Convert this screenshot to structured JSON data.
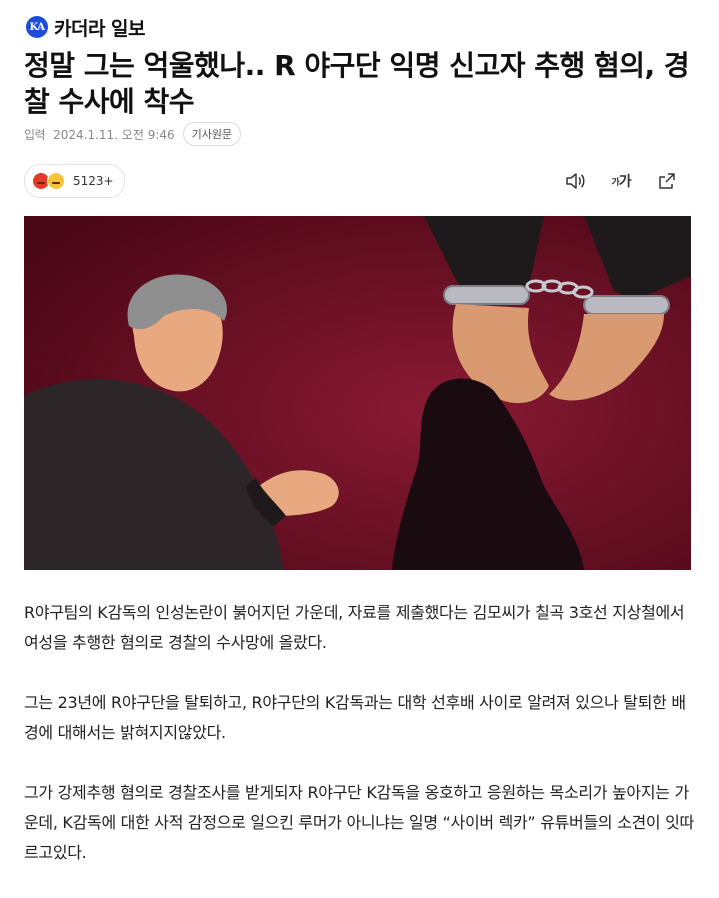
{
  "header": {
    "logo_mark": "KA",
    "brand": "카더라 일보"
  },
  "article": {
    "title": "정말 그는 억울했나.. R 야구단 익명 신고자 추행 혐의, 경찰 수사에 착수",
    "meta": {
      "label": "입력",
      "datetime": "2024.1.11. 오전 9:46",
      "original_button": "기사원문"
    },
    "reactions": {
      "icons": [
        "angry-emoji",
        "laugh-emoji"
      ],
      "count": "5123+"
    },
    "toolbar": {
      "icons": [
        "speaker-icon",
        "font-size-icon",
        "share-icon"
      ],
      "font_small": "가",
      "font_large": "가"
    },
    "image": {
      "subject": "handcuffed-hands-illustration",
      "background_color": "#6b0f24"
    },
    "paragraphs": [
      "R야구팀의 K감독의 인성논란이 붉어지던 가운데, 자료를 제출했다는 김모씨가 칠곡 3호선 지상철에서 여성을 추행한 혐의로 경찰의 수사망에 올랐다.",
      "그는 23년에 R야구단을 탈퇴하고, R야구단의 K감독과는 대학 선후배 사이로 알려져 있으나 탈퇴한 배경에 대해서는 밝혀지지않았다.",
      "그가 강제추행 혐의로 경찰조사를 받게되자 R야구단 K감독을 옹호하고 응원하는 목소리가 높아지는 가운데, K감독에 대한 사적 감정으로 일으킨 루머가 아니냐는 일명 “사이버 렉카” 유튜버들의 소견이 잇따르고있다."
    ]
  }
}
